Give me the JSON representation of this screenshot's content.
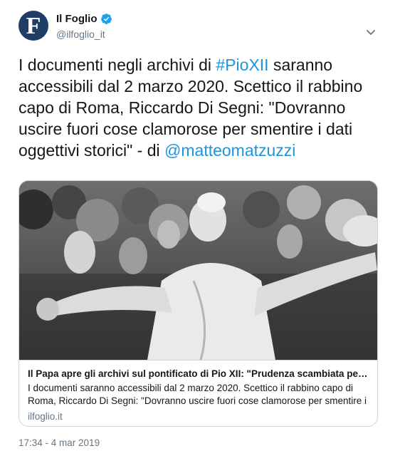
{
  "account": {
    "avatar_letter": "F",
    "display_name": "Il Foglio",
    "handle": "@ilfoglio_it",
    "verified": true
  },
  "tweet": {
    "text_1": "I documenti negli archivi di ",
    "hashtag": "#PioXII",
    "text_2": " saranno accessibili dal 2 marzo 2020. Scettico il rabbino capo di Roma, Riccardo Di Segni: \"Dovranno uscire fuori cose clamorose per smentire i dati oggettivi storici\" - di ",
    "mention": "@matteomatzuzzi"
  },
  "card": {
    "title": "Il Papa apre gli archivi sul pontificato di Pio XII: \"Prudenza scambiata per reti…",
    "description": "I documenti saranno accessibili dal 2 marzo 2020. Scettico il rabbino capo di Roma, Riccardo Di Segni: \"Dovranno uscire fuori cose clamorose per smentire i dati",
    "domain": "ilfoglio.it"
  },
  "timestamp": "17:34 - 4 mar 2019",
  "icons": {
    "verified": "verified-badge-icon",
    "caret": "chevron-down-icon"
  },
  "colors": {
    "link": "#1b95e0",
    "secondary_text": "#657786",
    "border": "#ccd6dd",
    "avatar_bg": "#1f3d66"
  }
}
